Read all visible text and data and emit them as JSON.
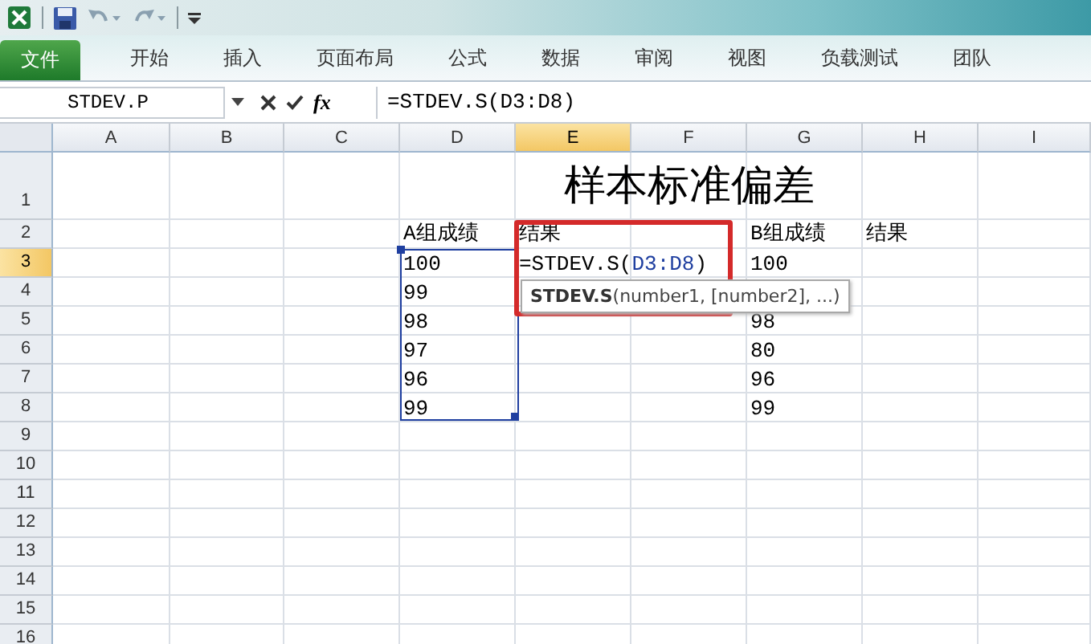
{
  "ribbon_tabs": [
    {
      "label": "文件",
      "kind": "file"
    },
    {
      "label": "开始",
      "kind": "tab"
    },
    {
      "label": "插入",
      "kind": "tab"
    },
    {
      "label": "页面布局",
      "kind": "tab"
    },
    {
      "label": "公式",
      "kind": "tab"
    },
    {
      "label": "数据",
      "kind": "tab"
    },
    {
      "label": "审阅",
      "kind": "tab"
    },
    {
      "label": "视图",
      "kind": "tab"
    },
    {
      "label": "负载测试",
      "kind": "tab"
    },
    {
      "label": "团队",
      "kind": "tab"
    }
  ],
  "formula_bar": {
    "name_box": "STDEV.P",
    "insert_function": "fx",
    "formula": "=STDEV.S(D3:D8)"
  },
  "columns": [
    {
      "label": "A",
      "selected": false
    },
    {
      "label": "B",
      "selected": false
    },
    {
      "label": "C",
      "selected": false
    },
    {
      "label": "D",
      "selected": false
    },
    {
      "label": "E",
      "selected": true
    },
    {
      "label": "F",
      "selected": false
    },
    {
      "label": "G",
      "selected": false
    },
    {
      "label": "H",
      "selected": false
    },
    {
      "label": "I",
      "selected": false
    }
  ],
  "rows": [
    {
      "label": "1",
      "selected": false,
      "cells": {
        "E": {
          "kind": "title",
          "text": "样本标准偏差"
        }
      }
    },
    {
      "label": "2",
      "selected": false,
      "cells": {
        "D": "A组成绩",
        "E": "结果",
        "G": "B组成绩",
        "H": "结果"
      }
    },
    {
      "label": "3",
      "selected": true,
      "cells": {
        "D": "100",
        "E": {
          "kind": "formula",
          "parts": [
            {
              "kind": "plain",
              "text": "=STDEV.S("
            },
            {
              "kind": "ref",
              "text": "D3:D8"
            },
            {
              "kind": "plain",
              "text": ")"
            }
          ]
        },
        "G": "100"
      }
    },
    {
      "label": "4",
      "selected": false,
      "cells": {
        "D": "99"
      }
    },
    {
      "label": "5",
      "selected": false,
      "cells": {
        "D": "98",
        "G": "98"
      }
    },
    {
      "label": "6",
      "selected": false,
      "cells": {
        "D": "97",
        "G": "80"
      }
    },
    {
      "label": "7",
      "selected": false,
      "cells": {
        "D": "96",
        "G": "96"
      }
    },
    {
      "label": "8",
      "selected": false,
      "cells": {
        "D": "99",
        "G": "99"
      }
    },
    {
      "label": "9",
      "selected": false,
      "cells": {}
    },
    {
      "label": "10",
      "selected": false,
      "cells": {}
    },
    {
      "label": "11",
      "selected": false,
      "cells": {}
    },
    {
      "label": "12",
      "selected": false,
      "cells": {}
    },
    {
      "label": "13",
      "selected": false,
      "cells": {}
    },
    {
      "label": "14",
      "selected": false,
      "cells": {}
    },
    {
      "label": "15",
      "selected": false,
      "cells": {}
    },
    {
      "label": "16",
      "selected": false,
      "cells": {}
    }
  ],
  "tooltip": {
    "text": "**STDEV.S**(number1, [number2], ...)"
  }
}
